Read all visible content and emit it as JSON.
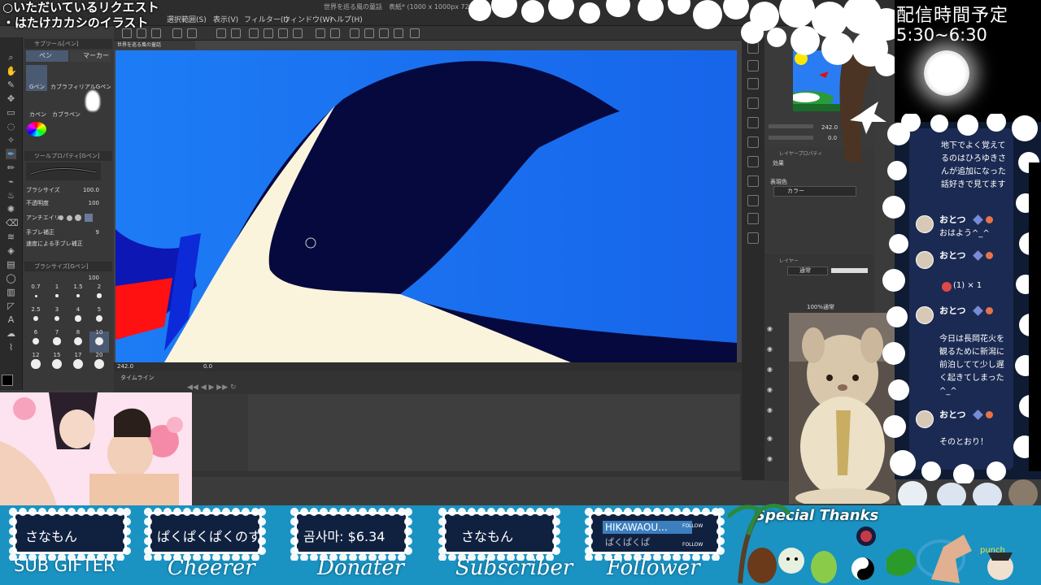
{
  "request": {
    "line1": "○いただいているリクエスト",
    "line2": "・はたけカカシのイラスト"
  },
  "menu": [
    {
      "label": "選択範囲(S)"
    },
    {
      "label": "表示(V)"
    },
    {
      "label": "フィルター(I)"
    },
    {
      "label": "ウィンドウ(W)"
    },
    {
      "label": "ヘルプ(H)"
    }
  ],
  "window_title": "世界を巡る風の童話　表紙* (1000 x 1000px 72dpi",
  "canvas_tab": "世界を巡る風の童話",
  "subtool": {
    "header": "サブツール[ペン]",
    "tabs": [
      "ペン",
      "マーカー"
    ],
    "brushes": [
      "Gペン",
      "カブラフィリアルGペン",
      "カペン",
      "カブラペン",
      "丸ペン"
    ],
    "properties_header": "ツールプロパティ[Gペン]",
    "brush_size_label": "ブラシサイズ",
    "brush_size_value": "100.0",
    "opacity_label": "不透明度",
    "opacity_value": "100",
    "antialias_label": "アンチエイリ",
    "stabilize_label": "手ブレ補正",
    "stabilize_value": "9",
    "speed_label": "速度による手ブレ補正",
    "brush_size_panel": "ブラシサイズ[Gペン]",
    "brush_size_panel_value": "100",
    "size_presets": [
      "0.7",
      "1",
      "1.5",
      "2",
      "2.5",
      "3",
      "4",
      "5",
      "6",
      "7",
      "8",
      "10",
      "12",
      "15",
      "17",
      "20"
    ]
  },
  "status": {
    "zoom": "242.0",
    "angle": "0.0"
  },
  "timeline": {
    "title": "タイムライン"
  },
  "navigator": {
    "zoom": "242.0",
    "angle": "0.0"
  },
  "layer_property": {
    "header": "レイヤープロパティ",
    "effect_label": "効果",
    "color_label": "表現色",
    "color_value": "カラー"
  },
  "layer_panel": {
    "header": "レイヤー",
    "blend": "通常",
    "top_layer": "100%通常"
  },
  "schedule": {
    "title": "配信時間予定",
    "time": "5:30~6:30"
  },
  "chat": [
    {
      "name": "",
      "text": "地下でよく覚えてるのはひろゆきさんが追加になった話好きで見てます"
    },
    {
      "name": "おとつ",
      "text": "おはよう^_^"
    },
    {
      "name": "おとつ",
      "text": "(1) × 1"
    },
    {
      "name": "おとつ",
      "text": "今日は長岡花火を観るために新潟に前泊してて少し遅く起きてしまった^_^"
    },
    {
      "name": "おとつ",
      "text": "そのとおり！"
    }
  ],
  "banner": {
    "boxes": [
      {
        "value": "さなもん",
        "label": "SUB GIFTER"
      },
      {
        "value": "ぱくぱくぱくのすば",
        "label": "Cheerer"
      },
      {
        "value": "곰사마: $6.34",
        "label": "Donater"
      },
      {
        "value": "さなもん",
        "label": "Subscriber"
      },
      {
        "value": "HIKAWAOU...",
        "value2": "ぱくぱくぱ",
        "follow": "FOLLOW",
        "label": "Follower"
      }
    ],
    "special": "Special Thanks"
  },
  "colors": {
    "canvas_bg": "#1e6cf0",
    "penguin_dark": "#06093d",
    "banner": "#1a93c2",
    "chat_bg": "#1b2a52"
  }
}
